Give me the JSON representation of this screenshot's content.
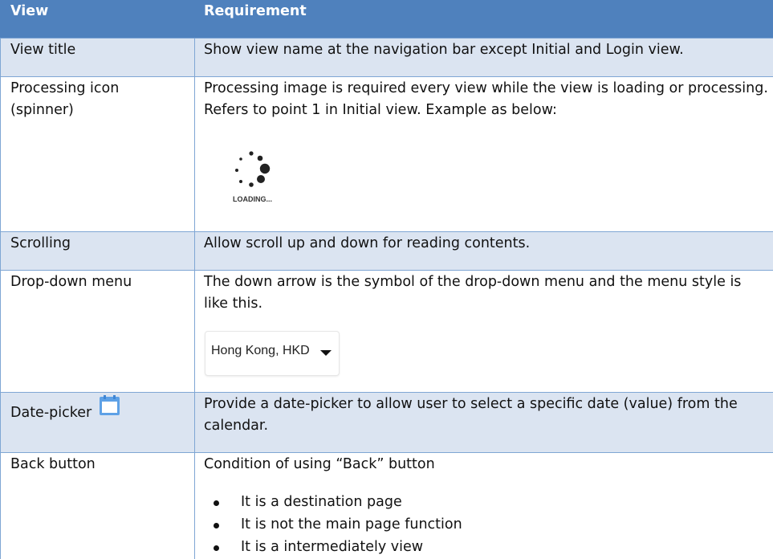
{
  "table": {
    "headers": {
      "view": "View",
      "requirement": "Requirement"
    },
    "rows": [
      {
        "view": "View title",
        "requirement": "Show view name at the navigation bar except Initial and Login view."
      },
      {
        "view": "Processing icon",
        "view2": "(spinner)",
        "requirement": "Processing image is required every view while the view is loading or processing.",
        "requirement2": "Refers to point 1 in Initial view.  Example as below:",
        "image_caption": "LOADING..."
      },
      {
        "view": "Scrolling",
        "requirement": "Allow scroll up and down for reading contents."
      },
      {
        "view": "Drop-down menu",
        "requirement": "The down arrow is the symbol of the drop-down menu and the menu style is",
        "requirement2": "like this.",
        "dropdown_value": "Hong Kong, HKD"
      },
      {
        "view": "Date-picker",
        "icon": "calendar-icon",
        "requirement": "Provide a date-picker to allow user to select a specific date (value) from the",
        "requirement2": "calendar."
      },
      {
        "view": "Back button",
        "requirement": "Condition of using “Back” button",
        "bullets": [
          "It is a destination page",
          "It is not the main page function",
          "It is a intermediately view"
        ]
      }
    ]
  },
  "colors": {
    "header": "#4f81bd",
    "shade": "#dbe4f1",
    "border": "#7fa6d4",
    "calendar": "#5ea1e6"
  }
}
